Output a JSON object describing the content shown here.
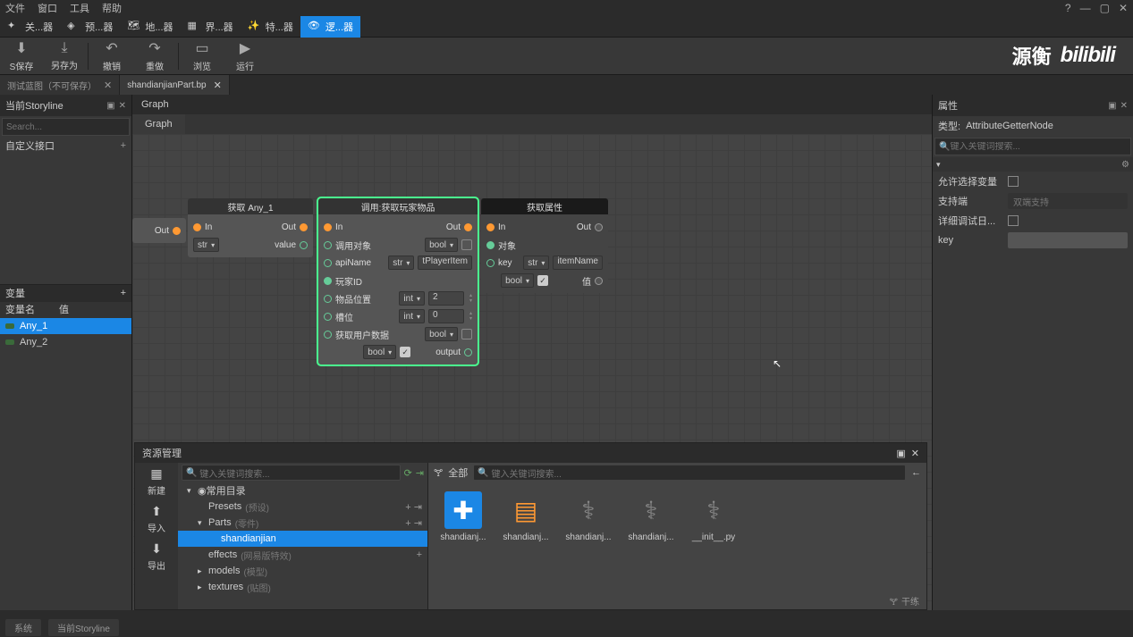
{
  "menu": {
    "file": "文件",
    "window": "窗口",
    "tools": "工具",
    "help": "帮助"
  },
  "modes": {
    "m1": "关...器",
    "m2": "预...器",
    "m3": "地...器",
    "m4": "界...器",
    "m5": "特...器",
    "m6": "逻...器"
  },
  "actions": {
    "save": "S保存",
    "saveas": "另存为",
    "undo": "撤销",
    "redo": "重做",
    "preview": "浏览",
    "run": "运行"
  },
  "watermark": {
    "text": "源衡",
    "logo": "bilibili"
  },
  "doctabs": {
    "t1": "测试蓝图（不可保存）",
    "t2": "shandianjianPart.bp"
  },
  "leftpanel": {
    "title": "当前Storyline",
    "search_ph": "Search...",
    "interface": "自定义接口",
    "vars_title": "变量",
    "col_name": "变量名",
    "col_val": "值",
    "var1": "Any_1",
    "var2": "Any_2"
  },
  "graph": {
    "title": "Graph",
    "tab": "Graph"
  },
  "nodes": {
    "n1": {
      "title": "获取 Any_1",
      "out": "Out",
      "in": "In",
      "value": "value",
      "type": "str"
    },
    "n2": {
      "title": "调用:获取玩家物品",
      "in": "In",
      "out": "Out",
      "r1": "调用对象",
      "r1type": "bool",
      "r2": "apiName",
      "r2type": "str",
      "r2val": "tPlayerItem",
      "r3": "玩家ID",
      "r4": "物品位置",
      "r4type": "int",
      "r4val": "2",
      "r5": "槽位",
      "r5type": "int",
      "r5val": "0",
      "r6": "获取用户数据",
      "r6type": "bool",
      "r7type": "bool",
      "r7out": "output"
    },
    "n3": {
      "title": "获取属性",
      "in": "In",
      "out": "Out",
      "r1": "对象",
      "r2": "key",
      "r2type": "str",
      "r2val": "itemName",
      "r3type": "bool",
      "r3out": "值"
    }
  },
  "rightpanel": {
    "title": "属性",
    "type_label": "类型:",
    "type_val": "AttributeGetterNode",
    "search_ph": "键入关键词搜索...",
    "p1": "允许选择变量",
    "p2": "支持端",
    "p2val": "双端支持",
    "p3": "详细调试日...",
    "p4": "key"
  },
  "resource": {
    "title": "资源管理",
    "new": "新建",
    "import": "导入",
    "export": "导出",
    "search_ph": "键入关键词搜索...",
    "filter_all": "全部",
    "root": "常用目录",
    "presets": "Presets",
    "presets_hint": "(预设)",
    "parts": "Parts",
    "parts_hint": "(零件)",
    "shandian": "shandianjian",
    "effects": "effects",
    "effects_hint": "(网易版特效)",
    "models": "models",
    "models_hint": "(模型)",
    "textures": "textures",
    "textures_hint": "(贴图)",
    "files": {
      "f1": "shandianj...",
      "f2": "shandianj...",
      "f3": "shandianj...",
      "f4": "shandianj...",
      "f5": "__init__.py"
    },
    "filter_label": "干练"
  },
  "status": {
    "s1": "系统",
    "s2": "当前Storyline"
  }
}
